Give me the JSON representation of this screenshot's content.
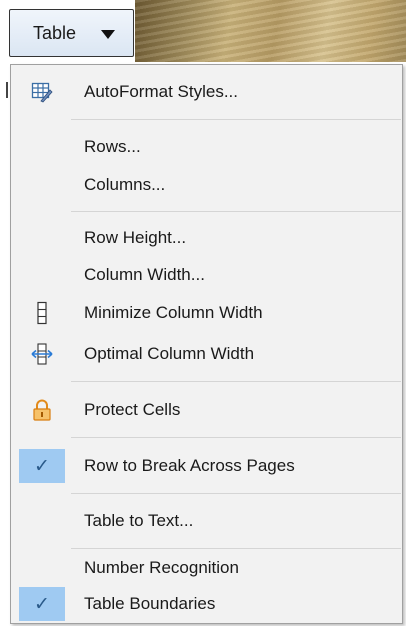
{
  "toolbar": {
    "table_button_label": "Table"
  },
  "menu": {
    "items": [
      {
        "label": "AutoFormat Styles...",
        "icon": "autoformat-icon"
      },
      {
        "label": "Rows..."
      },
      {
        "label": "Columns..."
      },
      {
        "label": "Row Height..."
      },
      {
        "label": "Column Width..."
      },
      {
        "label": "Minimize Column Width",
        "icon": "minimize-column-width-icon"
      },
      {
        "label": "Optimal Column Width",
        "icon": "optimal-column-width-icon"
      },
      {
        "label": "Protect Cells",
        "icon": "lock-icon"
      },
      {
        "label": "Row to Break Across Pages",
        "icon": "checkmark-icon",
        "checked": true
      },
      {
        "label": "Table to Text..."
      },
      {
        "label": "Number Recognition"
      },
      {
        "label": "Table Boundaries",
        "icon": "checkmark-icon",
        "checked": true
      }
    ]
  },
  "colors": {
    "menu_background": "#f2f2f2",
    "checked_highlight": "#9fcaf2",
    "separator": "#d5d5d5"
  }
}
